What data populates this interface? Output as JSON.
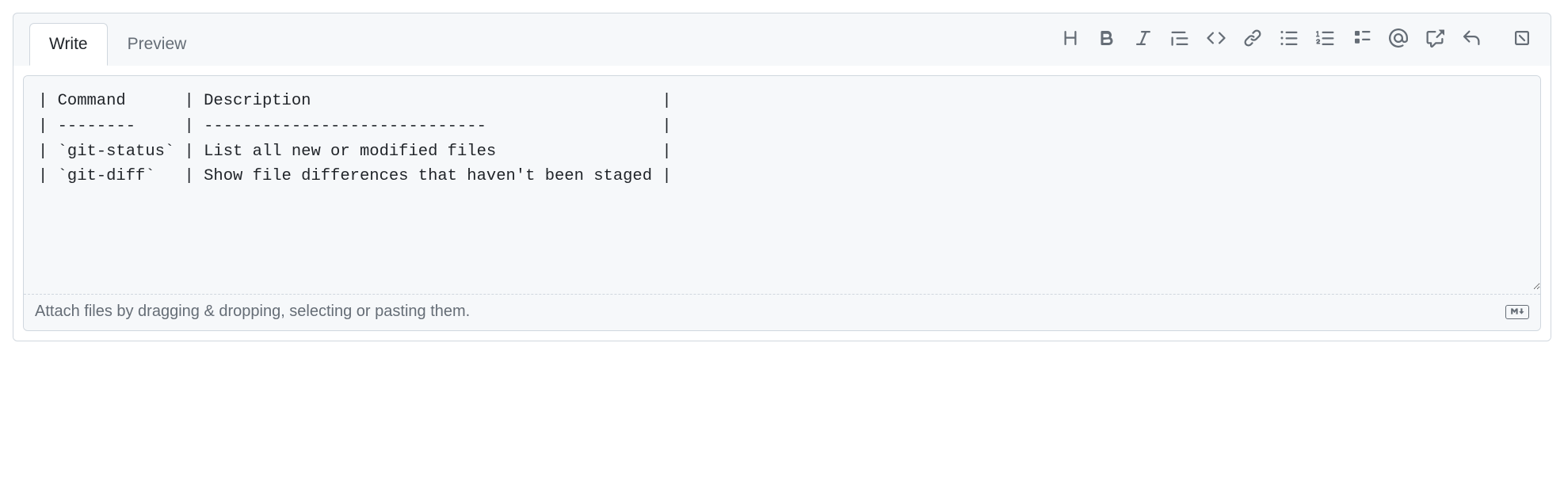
{
  "tabs": {
    "write": "Write",
    "preview": "Preview"
  },
  "editor": {
    "content": "| Command      | Description                                    |\n| --------     | -----------------------------                  |\n| `git-status` | List all new or modified files                 |\n| `git-diff`   | Show file differences that haven't been staged |"
  },
  "footer": {
    "attach_hint": "Attach files by dragging & dropping, selecting or pasting them."
  },
  "toolbar_icons": [
    "heading",
    "bold",
    "italic",
    "quote",
    "code",
    "link",
    "unordered-list",
    "ordered-list",
    "task-list",
    "mention",
    "cross-reference",
    "reply",
    "expand"
  ]
}
